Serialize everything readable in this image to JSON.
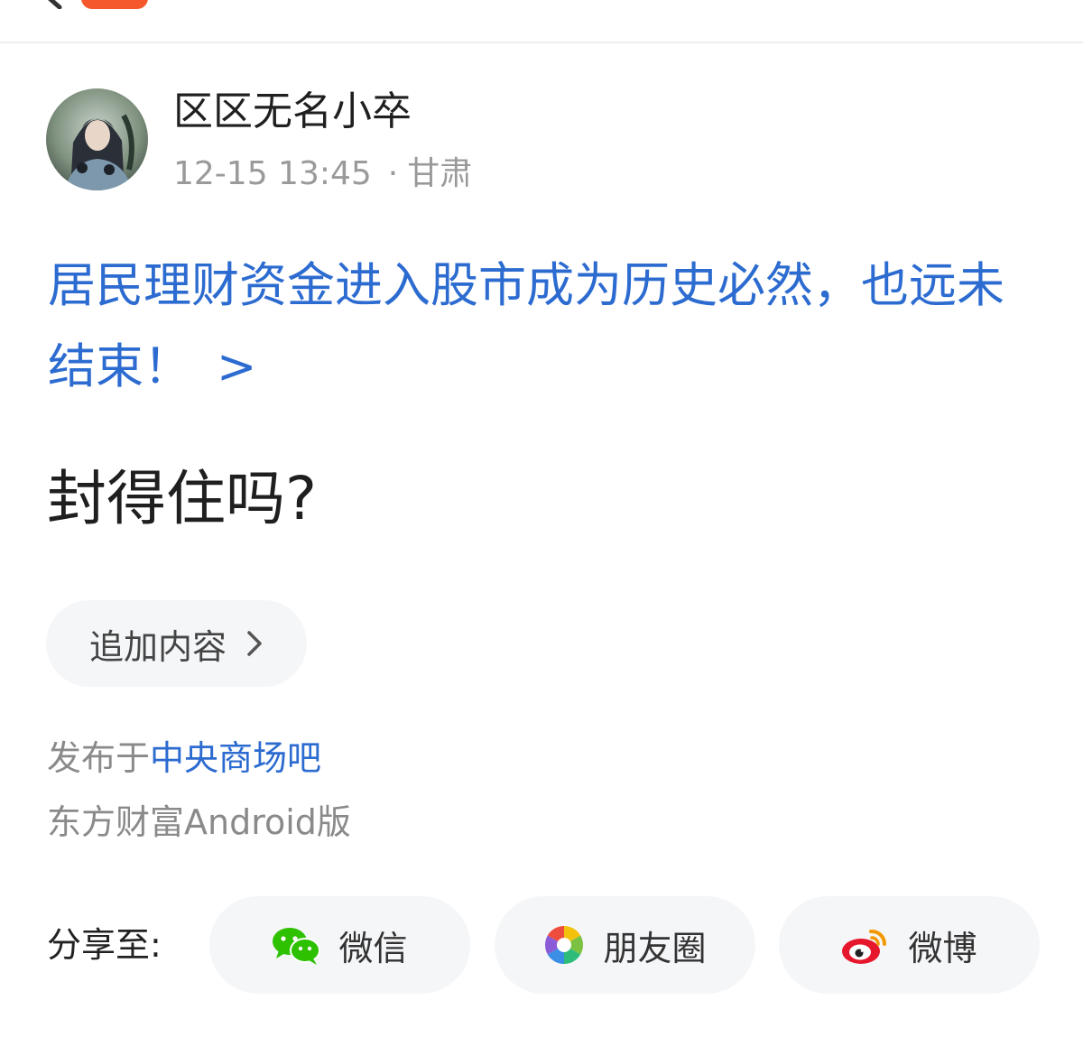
{
  "author": {
    "name": "区区无名小卒",
    "time": "12-15 13:45",
    "separator": "·",
    "location": "甘肃"
  },
  "topic_link": {
    "text": "居民理财资金进入股市成为历史必然，也远未结束！",
    "chevron": ">"
  },
  "post": {
    "body": "封得住吗?"
  },
  "append_button": {
    "label": "追加内容"
  },
  "footer": {
    "published_prefix": "发布于",
    "bar_name": "中央商场吧",
    "client": "东方财富Android版"
  },
  "share": {
    "label": "分享至:",
    "buttons": [
      {
        "label": "微信",
        "icon": "wechat-icon"
      },
      {
        "label": "朋友圈",
        "icon": "moments-icon"
      },
      {
        "label": "微博",
        "icon": "weibo-icon"
      }
    ]
  },
  "colors": {
    "link": "#2c6bd0",
    "badge": "#f4582c",
    "wechat": "#2dc100",
    "weibo": "#e6162d"
  }
}
